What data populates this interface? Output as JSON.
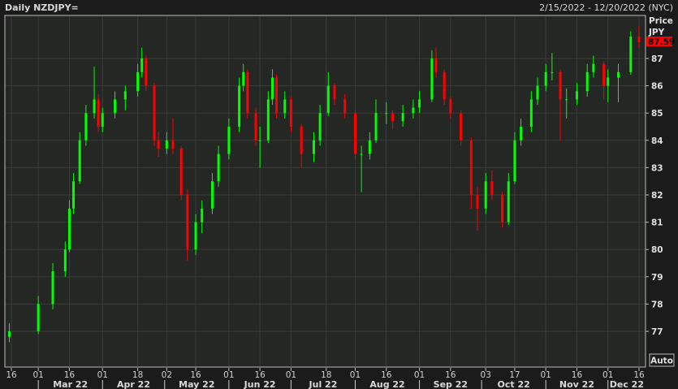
{
  "header": {
    "title": "Daily NZDJPY=",
    "range": "2/15/2022 - 12/20/2022 (NYC)"
  },
  "axis_panel": {
    "price_label": "Price",
    "currency": "JPY",
    "last_price": "87.59",
    "auto_button": "Auto"
  },
  "colors": {
    "up": "#00ff00",
    "down": "#ff0000",
    "background": "#1b1b1b",
    "plot": "#252725",
    "grid": "#3a3c3a",
    "last_price_bg": "#ff0000"
  },
  "chart_data": {
    "type": "candlestick",
    "title": "Daily NZDJPY=",
    "ylabel": "JPY",
    "ylim": [
      75.7,
      88.6
    ],
    "y_ticks": [
      77,
      78,
      79,
      80,
      81,
      82,
      83,
      84,
      85,
      86,
      87
    ],
    "grid": true,
    "x_ticks": [
      {
        "label": "16",
        "date": "2022-02-16"
      },
      {
        "label": "01",
        "date": "2022-03-01"
      },
      {
        "label": "16",
        "date": "2022-03-16"
      },
      {
        "label": "01",
        "date": "2022-04-01"
      },
      {
        "label": "18",
        "date": "2022-04-18"
      },
      {
        "label": "02",
        "date": "2022-05-02"
      },
      {
        "label": "16",
        "date": "2022-05-16"
      },
      {
        "label": "01",
        "date": "2022-06-01"
      },
      {
        "label": "16",
        "date": "2022-06-16"
      },
      {
        "label": "01",
        "date": "2022-07-01"
      },
      {
        "label": "18",
        "date": "2022-07-18"
      },
      {
        "label": "01",
        "date": "2022-08-01"
      },
      {
        "label": "16",
        "date": "2022-08-16"
      },
      {
        "label": "01",
        "date": "2022-09-01"
      },
      {
        "label": "16",
        "date": "2022-09-16"
      },
      {
        "label": "03",
        "date": "2022-10-03"
      },
      {
        "label": "17",
        "date": "2022-10-17"
      },
      {
        "label": "01",
        "date": "2022-11-01"
      },
      {
        "label": "16",
        "date": "2022-11-16"
      },
      {
        "label": "01",
        "date": "2022-12-01"
      },
      {
        "label": "16",
        "date": "2022-12-16"
      }
    ],
    "months": [
      {
        "label": "Mar 22",
        "start": "2022-03-01",
        "end": "2022-04-01"
      },
      {
        "label": "Apr 22",
        "start": "2022-04-01",
        "end": "2022-05-01"
      },
      {
        "label": "May 22",
        "start": "2022-05-01",
        "end": "2022-06-01"
      },
      {
        "label": "Jun 22",
        "start": "2022-06-01",
        "end": "2022-07-01"
      },
      {
        "label": "Jul 22",
        "start": "2022-07-01",
        "end": "2022-08-01"
      },
      {
        "label": "Aug 22",
        "start": "2022-08-01",
        "end": "2022-09-01"
      },
      {
        "label": "Sep 22",
        "start": "2022-09-01",
        "end": "2022-10-01"
      },
      {
        "label": "Oct 22",
        "start": "2022-10-01",
        "end": "2022-11-01"
      },
      {
        "label": "Nov 22",
        "start": "2022-11-01",
        "end": "2022-12-01"
      },
      {
        "label": "Dec 22",
        "start": "2022-12-01",
        "end": "2022-12-22"
      }
    ],
    "candle_fields": [
      "date",
      "open",
      "high",
      "low",
      "close"
    ],
    "candles": [
      [
        "2022-02-15",
        76.8,
        77.3,
        76.6,
        77.0
      ],
      [
        "2022-03-01",
        77.0,
        78.3,
        76.9,
        78.0
      ],
      [
        "2022-03-08",
        78.0,
        79.5,
        77.8,
        79.2
      ],
      [
        "2022-03-14",
        79.2,
        80.3,
        79.0,
        80.0
      ],
      [
        "2022-03-16",
        80.0,
        81.8,
        79.9,
        81.5
      ],
      [
        "2022-03-18",
        81.5,
        82.8,
        81.3,
        82.5
      ],
      [
        "2022-03-21",
        82.5,
        84.3,
        82.4,
        84.0
      ],
      [
        "2022-03-24",
        84.0,
        85.3,
        83.8,
        85.0
      ],
      [
        "2022-03-28",
        85.0,
        86.7,
        84.8,
        85.5
      ],
      [
        "2022-03-30",
        85.5,
        85.7,
        84.3,
        84.5
      ],
      [
        "2022-04-01",
        84.5,
        85.2,
        84.3,
        85.0
      ],
      [
        "2022-04-07",
        85.0,
        85.8,
        84.8,
        85.5
      ],
      [
        "2022-04-12",
        85.5,
        86.0,
        85.1,
        85.8
      ],
      [
        "2022-04-18",
        85.8,
        86.8,
        85.6,
        86.5
      ],
      [
        "2022-04-20",
        86.5,
        87.4,
        86.3,
        87.0
      ],
      [
        "2022-04-22",
        87.0,
        87.1,
        85.8,
        86.0
      ],
      [
        "2022-04-26",
        86.0,
        86.1,
        83.8,
        84.0
      ],
      [
        "2022-04-28",
        84.0,
        84.3,
        83.4,
        83.7
      ],
      [
        "2022-05-02",
        83.7,
        84.3,
        83.5,
        84.0
      ],
      [
        "2022-05-05",
        84.0,
        84.8,
        83.5,
        83.7
      ],
      [
        "2022-05-09",
        83.7,
        83.8,
        81.8,
        82.0
      ],
      [
        "2022-05-12",
        82.0,
        82.2,
        79.6,
        80.0
      ],
      [
        "2022-05-16",
        80.0,
        81.3,
        79.8,
        81.0
      ],
      [
        "2022-05-19",
        81.0,
        81.8,
        80.6,
        81.5
      ],
      [
        "2022-05-24",
        81.5,
        82.8,
        81.3,
        82.5
      ],
      [
        "2022-05-27",
        82.5,
        83.8,
        82.3,
        83.5
      ],
      [
        "2022-06-01",
        83.5,
        84.8,
        83.3,
        84.5
      ],
      [
        "2022-06-06",
        84.5,
        86.3,
        84.3,
        86.0
      ],
      [
        "2022-06-08",
        86.0,
        86.8,
        85.8,
        86.5
      ],
      [
        "2022-06-10",
        86.5,
        86.6,
        84.8,
        85.0
      ],
      [
        "2022-06-14",
        85.0,
        85.2,
        83.8,
        84.0
      ],
      [
        "2022-06-16",
        84.0,
        84.5,
        83.0,
        84.0
      ],
      [
        "2022-06-20",
        84.0,
        85.8,
        83.9,
        85.5
      ],
      [
        "2022-06-22",
        85.5,
        86.6,
        85.3,
        86.3
      ],
      [
        "2022-06-24",
        86.3,
        86.4,
        84.8,
        85.0
      ],
      [
        "2022-06-28",
        85.0,
        85.8,
        84.8,
        85.5
      ],
      [
        "2022-07-01",
        85.5,
        85.6,
        84.3,
        84.5
      ],
      [
        "2022-07-06",
        84.5,
        84.6,
        83.0,
        83.5
      ],
      [
        "2022-07-12",
        83.5,
        84.3,
        83.2,
        84.0
      ],
      [
        "2022-07-15",
        84.0,
        85.3,
        83.8,
        85.0
      ],
      [
        "2022-07-19",
        85.0,
        86.5,
        84.9,
        86.0
      ],
      [
        "2022-07-22",
        86.0,
        86.1,
        85.3,
        85.5
      ],
      [
        "2022-07-27",
        85.5,
        85.7,
        84.8,
        85.0
      ],
      [
        "2022-08-01",
        85.0,
        85.1,
        83.3,
        83.5
      ],
      [
        "2022-08-04",
        83.5,
        83.8,
        82.1,
        83.5
      ],
      [
        "2022-08-08",
        83.5,
        84.3,
        83.3,
        84.0
      ],
      [
        "2022-08-11",
        84.0,
        85.5,
        83.9,
        85.0
      ],
      [
        "2022-08-16",
        85.0,
        85.4,
        84.6,
        85.0
      ],
      [
        "2022-08-19",
        85.0,
        85.1,
        84.4,
        84.7
      ],
      [
        "2022-08-24",
        84.7,
        85.3,
        84.5,
        85.0
      ],
      [
        "2022-08-29",
        85.0,
        85.5,
        84.8,
        85.2
      ],
      [
        "2022-09-01",
        85.2,
        85.8,
        85.0,
        85.5
      ],
      [
        "2022-09-07",
        85.5,
        87.3,
        85.4,
        87.0
      ],
      [
        "2022-09-09",
        87.0,
        87.4,
        86.3,
        86.5
      ],
      [
        "2022-09-13",
        86.5,
        86.6,
        85.3,
        85.5
      ],
      [
        "2022-09-16",
        85.5,
        85.6,
        84.8,
        85.0
      ],
      [
        "2022-09-21",
        85.0,
        85.1,
        83.8,
        84.0
      ],
      [
        "2022-09-26",
        84.0,
        84.1,
        81.5,
        82.0
      ],
      [
        "2022-09-29",
        82.0,
        82.3,
        80.7,
        81.5
      ],
      [
        "2022-10-03",
        81.5,
        82.8,
        81.3,
        82.5
      ],
      [
        "2022-10-06",
        82.5,
        82.9,
        81.8,
        82.0
      ],
      [
        "2022-10-11",
        82.0,
        82.1,
        80.8,
        81.0
      ],
      [
        "2022-10-14",
        81.0,
        82.8,
        80.9,
        82.5
      ],
      [
        "2022-10-17",
        82.5,
        84.3,
        82.4,
        84.0
      ],
      [
        "2022-10-20",
        84.0,
        84.8,
        83.8,
        84.5
      ],
      [
        "2022-10-25",
        84.5,
        85.8,
        84.3,
        85.5
      ],
      [
        "2022-10-28",
        85.5,
        86.3,
        85.3,
        86.0
      ],
      [
        "2022-11-01",
        86.0,
        86.8,
        85.8,
        86.5
      ],
      [
        "2022-11-04",
        86.5,
        87.2,
        86.2,
        86.5
      ],
      [
        "2022-11-08",
        86.5,
        86.6,
        84.0,
        85.5
      ],
      [
        "2022-11-11",
        85.5,
        85.9,
        84.8,
        85.5
      ],
      [
        "2022-11-16",
        85.5,
        86.1,
        85.3,
        85.8
      ],
      [
        "2022-11-21",
        85.8,
        86.8,
        85.6,
        86.5
      ],
      [
        "2022-11-24",
        86.5,
        87.1,
        86.3,
        86.8
      ],
      [
        "2022-11-29",
        86.8,
        86.9,
        85.5,
        86.0
      ],
      [
        "2022-12-01",
        86.0,
        86.6,
        85.4,
        86.3
      ],
      [
        "2022-12-06",
        86.3,
        86.8,
        85.4,
        86.5
      ],
      [
        "2022-12-12",
        86.5,
        88.0,
        86.4,
        87.8
      ],
      [
        "2022-12-16",
        87.8,
        88.2,
        87.4,
        87.59
      ]
    ]
  }
}
